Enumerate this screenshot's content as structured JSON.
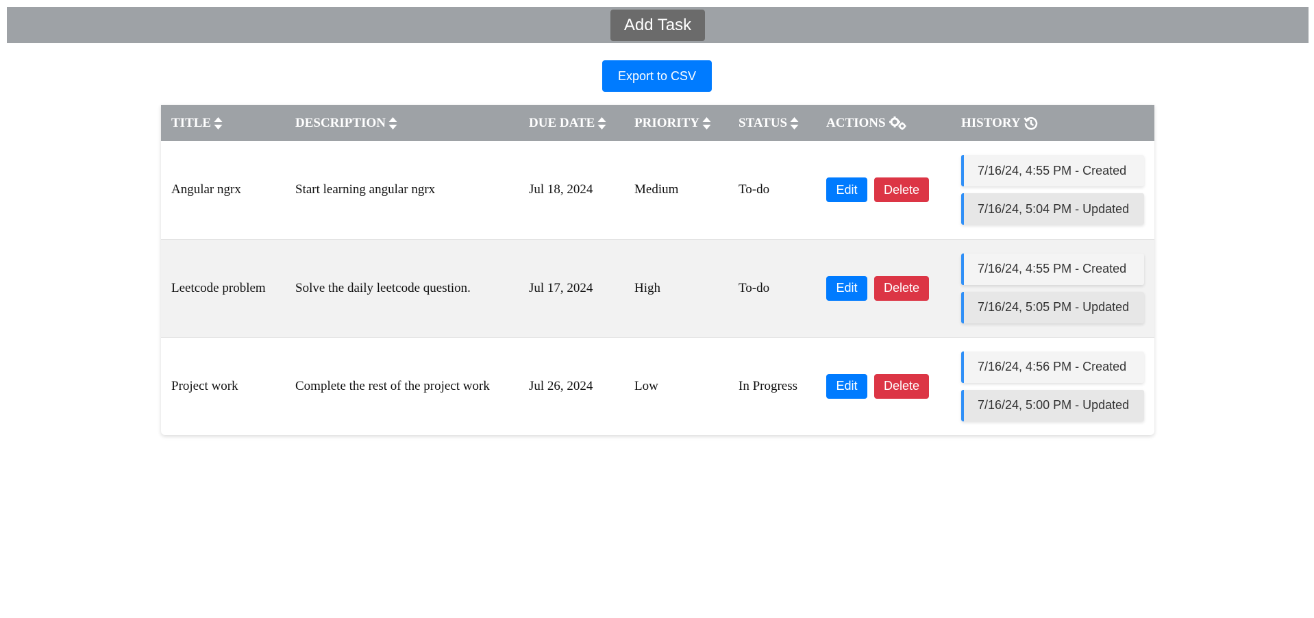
{
  "toolbar": {
    "add_task_label": "Add Task"
  },
  "export": {
    "label": "Export to CSV"
  },
  "table": {
    "headers": {
      "title": "TITLE",
      "description": "DESCRIPTION",
      "due_date": "DUE DATE",
      "priority": "PRIORITY",
      "status": "STATUS",
      "actions": "ACTIONS",
      "history": "HISTORY"
    },
    "header_icons": {
      "sort": "sort-icon",
      "actions": "gears-icon",
      "history": "history-icon"
    },
    "edit_label": "Edit",
    "delete_label": "Delete",
    "history_separator": "-",
    "rows": [
      {
        "title": "Angular ngrx",
        "description": "Start learning angular ngrx",
        "due_date": "Jul 18, 2024",
        "priority": "Medium",
        "status": "To-do",
        "history": [
          {
            "time": "7/16/24, 4:55 PM",
            "action": "Created"
          },
          {
            "time": "7/16/24, 5:04 PM",
            "action": "Updated"
          }
        ]
      },
      {
        "title": "Leetcode problem",
        "description": "Solve the daily leetcode question.",
        "due_date": "Jul 17, 2024",
        "priority": "High",
        "status": "To-do",
        "history": [
          {
            "time": "7/16/24, 4:55 PM",
            "action": "Created"
          },
          {
            "time": "7/16/24, 5:05 PM",
            "action": "Updated"
          }
        ]
      },
      {
        "title": "Project work",
        "description": "Complete the rest of the project work",
        "due_date": "Jul 26, 2024",
        "priority": "Low",
        "status": "In Progress",
        "history": [
          {
            "time": "7/16/24, 4:56 PM",
            "action": "Created"
          },
          {
            "time": "7/16/24, 5:00 PM",
            "action": "Updated"
          }
        ]
      }
    ]
  },
  "colors": {
    "header_bar": "#9ea2a6",
    "add_task_button": "#6b6b6b",
    "primary": "#007bff",
    "danger": "#dc3545",
    "history_accent": "#2f8ff7"
  }
}
